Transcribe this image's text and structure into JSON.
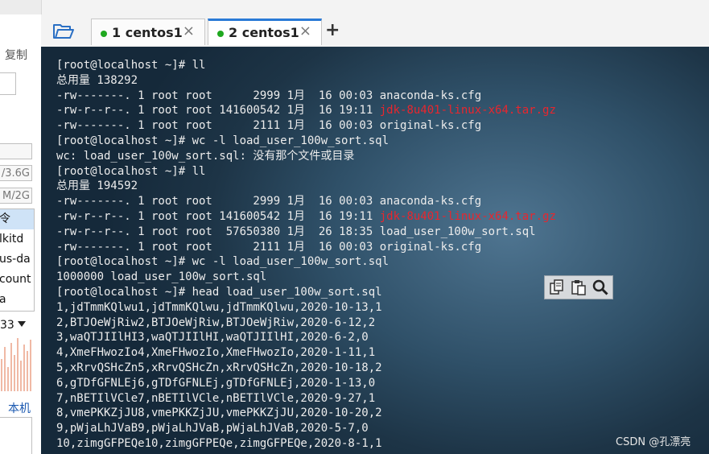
{
  "left_panel": {
    "copy_label": "复制",
    "fields": [
      "/3.6G",
      "M/2G"
    ],
    "list_items": [
      "令",
      "lkitd",
      "us-da",
      "count",
      "a"
    ],
    "number_value": "33",
    "local_label": "本机"
  },
  "tabs": [
    {
      "label": "1 centos1",
      "active": false
    },
    {
      "label": "2 centos1",
      "active": true
    }
  ],
  "terminal": {
    "lines": [
      [
        {
          "t": "[root@localhost ~]# ll"
        }
      ],
      [
        {
          "t": "总用量 138292"
        }
      ],
      [
        {
          "t": "-rw-------. 1 root root      2999 1月  16 00:03 anaconda-ks.cfg"
        }
      ],
      [
        {
          "t": "-rw-r--r--. 1 root root 141600542 1月  16 19:11 "
        },
        {
          "t": "jdk-8u401-linux-x64.tar.gz",
          "c": "red"
        }
      ],
      [
        {
          "t": "-rw-------. 1 root root      2111 1月  16 00:03 original-ks.cfg"
        }
      ],
      [
        {
          "t": "[root@localhost ~]# wc -l load_user_100w_sort.sql"
        }
      ],
      [
        {
          "t": "wc: load_user_100w_sort.sql: 没有那个文件或目录"
        }
      ],
      [
        {
          "t": "[root@localhost ~]# ll"
        }
      ],
      [
        {
          "t": "总用量 194592"
        }
      ],
      [
        {
          "t": "-rw-------. 1 root root      2999 1月  16 00:03 anaconda-ks.cfg"
        }
      ],
      [
        {
          "t": "-rw-r--r--. 1 root root 141600542 1月  16 19:11 "
        },
        {
          "t": "jdk-8u401-linux-x64.tar.gz",
          "c": "red"
        }
      ],
      [
        {
          "t": "-rw-r--r--. 1 root root  57650380 1月  26 18:35 load_user_100w_sort.sql"
        }
      ],
      [
        {
          "t": "-rw-------. 1 root root      2111 1月  16 00:03 original-ks.cfg"
        }
      ],
      [
        {
          "t": "[root@localhost ~]# wc -l load_user_100w_sort.sql"
        }
      ],
      [
        {
          "t": "1000000 load_user_100w_sort.sql"
        }
      ],
      [
        {
          "t": "[root@localhost ~]# head load_user_100w_sort.sql"
        }
      ],
      [
        {
          "t": "1,jdTmmKQlwu1,jdTmmKQlwu,jdTmmKQlwu,2020-10-13,1"
        }
      ],
      [
        {
          "t": "2,BTJOeWjRiw2,BTJOeWjRiw,BTJOeWjRiw,2020-6-12,2"
        }
      ],
      [
        {
          "t": "3,waQTJIIlHI3,waQTJIIlHI,waQTJIIlHI,2020-6-2,0"
        }
      ],
      [
        {
          "t": "4,XmeFHwozIo4,XmeFHwozIo,XmeFHwozIo,2020-1-11,1"
        }
      ],
      [
        {
          "t": "5,xRrvQSHcZn5,xRrvQSHcZn,xRrvQSHcZn,2020-10-18,2"
        }
      ],
      [
        {
          "t": "6,gTDfGFNLEj6,gTDfGFNLEj,gTDfGFNLEj,2020-1-13,0"
        }
      ],
      [
        {
          "t": "7,nBETIlVCle7,nBETIlVCle,nBETIlVCle,2020-9-27,1"
        }
      ],
      [
        {
          "t": "8,vmePKKZjJU8,vmePKKZjJU,vmePKKZjJU,2020-10-20,2"
        }
      ],
      [
        {
          "t": "9,pWjaLhJVaB9,pWjaLhJVaB,pWjaLhJVaB,2020-5-7,0"
        }
      ],
      [
        {
          "t": "10,zimgGFPEQe10,zimgGFPEQe,zimgGFPEQe,2020-8-1,1"
        }
      ]
    ],
    "mini_toolbar_icons": [
      "copy-icon",
      "paste-icon",
      "search-icon"
    ]
  },
  "watermark": "CSDN @孔漂亮",
  "colors": {
    "accent": "#2a7ad6",
    "status_green": "#1fa81f",
    "archive_red": "#e8262e",
    "terminal_text": "#ececec"
  }
}
